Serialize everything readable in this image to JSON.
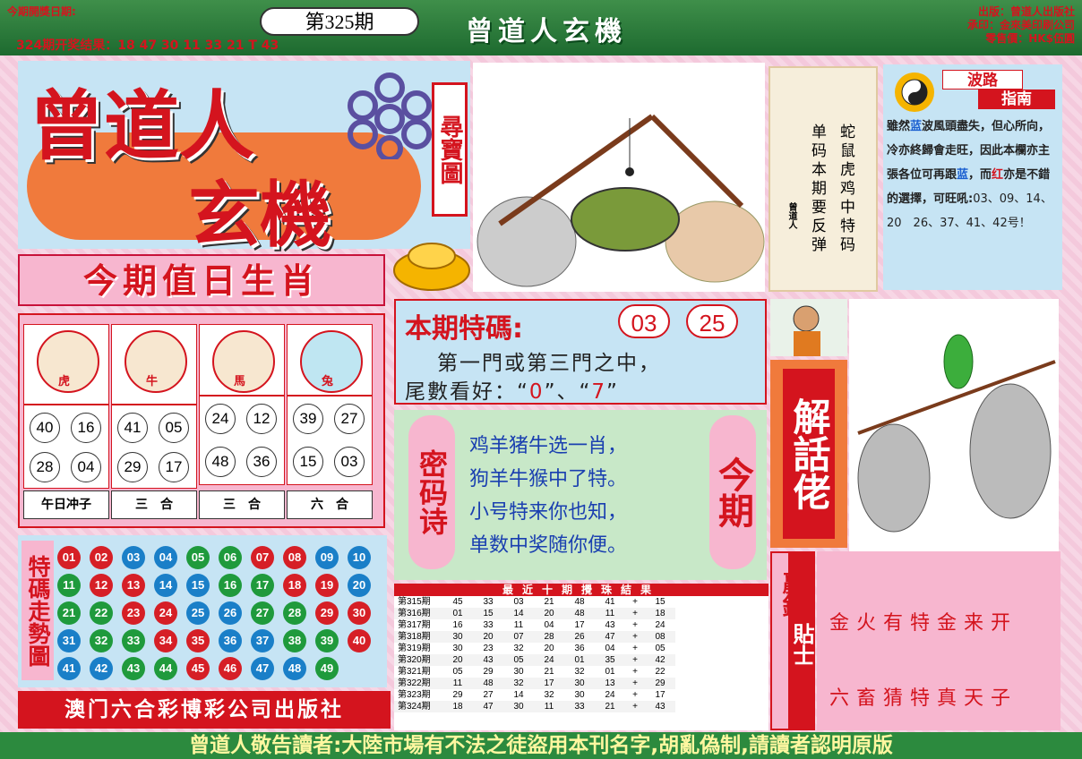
{
  "header": {
    "issue_date_label": "今期開獎日期:",
    "issue_number": "第325期",
    "last_result": "324期开奖结果：18 47 30 11 33 21 T 43",
    "center_title": "曾道人玄機",
    "publisher_lines": [
      "出版：曾道人出版社",
      "承印：金來美印刷公司",
      "零售價：HK$伍圓"
    ]
  },
  "logo": {
    "title_top": "曾道人",
    "title_bottom": "玄機",
    "side_label": "尋寶圖"
  },
  "daily_zodiac": {
    "title": "今期值日生肖",
    "animals": [
      {
        "name": "虎",
        "icon": "tiger-icon",
        "numbers": [
          "40",
          "16",
          "28",
          "04"
        ],
        "footer": "午日冲子"
      },
      {
        "name": "牛",
        "icon": "ox-icon",
        "numbers": [
          "41",
          "05",
          "29",
          "17"
        ],
        "footer": "三　合"
      },
      {
        "name": "馬",
        "icon": "horse-icon",
        "numbers": [
          "24",
          "12",
          "48",
          "36"
        ],
        "footer": "三　合"
      },
      {
        "name": "兔",
        "icon": "rabbit-icon",
        "numbers": [
          "39",
          "27",
          "15",
          "03"
        ],
        "footer": "六　合"
      }
    ]
  },
  "trend": {
    "title": "特碼走勢圖",
    "numbers": [
      "01",
      "02",
      "03",
      "04",
      "05",
      "06",
      "07",
      "08",
      "09",
      "10",
      "11",
      "12",
      "13",
      "14",
      "15",
      "16",
      "17",
      "18",
      "19",
      "20",
      "21",
      "22",
      "23",
      "24",
      "25",
      "26",
      "27",
      "28",
      "29",
      "30",
      "31",
      "32",
      "33",
      "34",
      "35",
      "36",
      "37",
      "38",
      "39",
      "40",
      "41",
      "42",
      "43",
      "44",
      "45",
      "46",
      "47",
      "48",
      "49"
    ],
    "colors": {
      "red": "#d61f26",
      "blue": "#1a7fc8",
      "green": "#1f9a3c"
    }
  },
  "publisher_footer": "澳门六合彩博彩公司出版社",
  "poem_box": {
    "lines": [
      "蛇",
      "鼠",
      "虎",
      "鸡",
      "中",
      "特",
      "码"
    ],
    "line2": "单码本期要反弹",
    "signature": "曾道人"
  },
  "wave_guide": {
    "title_top": "波路",
    "title_bottom": "指南",
    "text_1": "雖然",
    "text_blue": "蓝",
    "text_2": "波風頭盡失，但心所向，冷亦終歸會走旺，因此本欄亦主張各位可再跟",
    "text_blue2": "蓝",
    "text_3": "，而",
    "text_red": "红",
    "text_4": "亦是不錯的選擇，可旺吼:",
    "numbers": "03、09、14、20　26、37、41、42号！"
  },
  "special_code": {
    "label": "本期特碼:",
    "codes": [
      "03",
      "25"
    ],
    "line1": "第一門或第三門之中，",
    "line2_a": "尾數看好：“",
    "tail1": "0",
    "line2_b": "”、“",
    "tail2": "7",
    "line2_c": "”"
  },
  "secret_poem": {
    "side_left": "密码诗",
    "side_right": "今期",
    "lines": [
      "鸡羊猪牛选一肖，",
      "狗羊牛猴中了特。",
      "小号特来你也知，",
      "单数中奖随你便。"
    ]
  },
  "history": {
    "title": "最近十期攪珠結果",
    "rows": [
      {
        "period": "第315期",
        "nums": [
          "45",
          "33",
          "03",
          "21",
          "48",
          "41"
        ],
        "special": "15"
      },
      {
        "period": "第316期",
        "nums": [
          "01",
          "15",
          "14",
          "20",
          "48",
          "11"
        ],
        "special": "18"
      },
      {
        "period": "第317期",
        "nums": [
          "16",
          "33",
          "11",
          "04",
          "17",
          "43"
        ],
        "special": "24"
      },
      {
        "period": "第318期",
        "nums": [
          "30",
          "20",
          "07",
          "28",
          "26",
          "47"
        ],
        "special": "08"
      },
      {
        "period": "第319期",
        "nums": [
          "30",
          "23",
          "32",
          "20",
          "36",
          "04"
        ],
        "special": "05"
      },
      {
        "period": "第320期",
        "nums": [
          "20",
          "43",
          "05",
          "24",
          "01",
          "35"
        ],
        "special": "42"
      },
      {
        "period": "第321期",
        "nums": [
          "05",
          "29",
          "30",
          "21",
          "32",
          "01"
        ],
        "special": "22"
      },
      {
        "period": "第322期",
        "nums": [
          "11",
          "48",
          "32",
          "17",
          "30",
          "13"
        ],
        "special": "29"
      },
      {
        "period": "第323期",
        "nums": [
          "29",
          "27",
          "14",
          "32",
          "30",
          "24"
        ],
        "special": "17"
      },
      {
        "period": "第324期",
        "nums": [
          "18",
          "47",
          "30",
          "11",
          "33",
          "21"
        ],
        "special": "43"
      }
    ],
    "plus": "+"
  },
  "riddle": {
    "title": "解話佬"
  },
  "tips": {
    "side_a": "贏錢",
    "side_b": "貼士",
    "line1": "金火有特金来开",
    "line2": "六畜猜特真天子"
  },
  "bottom_banner": "曾道人敬告讀者:大陸市場有不法之徒盜用本刊名字,胡亂偽制,請讀者認明原版"
}
